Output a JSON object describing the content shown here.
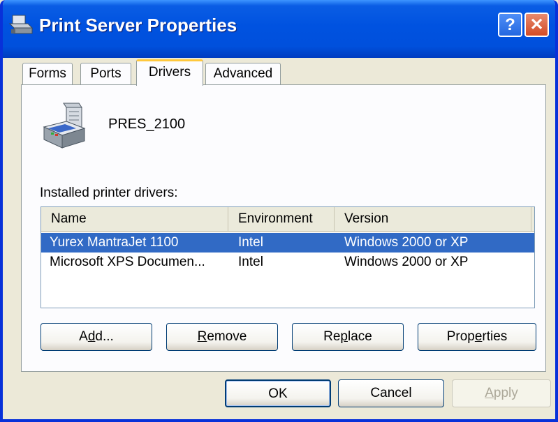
{
  "window": {
    "title": "Print Server Properties"
  },
  "titlebar": {
    "help_label": "?",
    "close_label": "✕"
  },
  "tabs": [
    {
      "label": "Forms"
    },
    {
      "label": "Ports"
    },
    {
      "label": "Drivers",
      "active": true
    },
    {
      "label": "Advanced"
    }
  ],
  "server": {
    "name": "PRES_2100"
  },
  "drivers": {
    "label": "Installed printer drivers:",
    "columns": [
      "Name",
      "Environment",
      "Version"
    ],
    "rows": [
      {
        "name": "Yurex MantraJet 1100",
        "environment": "Intel",
        "version": "Windows 2000 or XP",
        "selected": true
      },
      {
        "name": "Microsoft XPS Documen...",
        "environment": "Intel",
        "version": "Windows 2000 or XP",
        "selected": false
      }
    ]
  },
  "buttons": {
    "add": {
      "pre": "A",
      "key": "d",
      "post": "d..."
    },
    "remove": {
      "pre": "",
      "key": "R",
      "post": "emove"
    },
    "replace": {
      "pre": "Re",
      "key": "p",
      "post": "lace"
    },
    "properties": {
      "pre": "Prop",
      "key": "e",
      "post": "rties"
    }
  },
  "footer": {
    "ok": "OK",
    "cancel": "Cancel",
    "apply_pre": "",
    "apply_key": "A",
    "apply_post": "pply"
  },
  "colors": {
    "titlebar": "#0052e0",
    "selection": "#316ac5",
    "face": "#ece9d8",
    "tab_accent": "#ffc83c"
  }
}
